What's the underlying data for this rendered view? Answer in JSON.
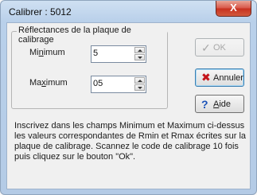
{
  "window": {
    "title": "Calibrer : 5012",
    "close_glyph": "X"
  },
  "group": {
    "legend": "Réflectances de la plaque de calibrage",
    "minimum": {
      "label_pre": "Mi",
      "label_acc": "n",
      "label_post": "imum",
      "value": "5"
    },
    "maximum": {
      "label_pre": "Ma",
      "label_acc": "x",
      "label_post": "imum",
      "value": "05"
    }
  },
  "buttons": {
    "ok": {
      "label": "OK",
      "icon": "check-icon",
      "enabled": false
    },
    "cancel": {
      "label": "Annuler",
      "icon": "x-icon"
    },
    "help": {
      "label_acc": "A",
      "label_post": "ide",
      "icon": "question-icon"
    }
  },
  "help_text": "Inscrivez dans les champs Minimum et Maximum ci-dessus les valeurs correspondantes de Rmin et Rmax écrites sur la plaque de calibrage. Scannez le code de calibrage 10 fois puis cliquez sur le bouton \"Ok\".",
  "colors": {
    "title_bar": "#b9d0ea",
    "close_button": "#c7301f",
    "cancel_icon": "#c4141a",
    "help_icon": "#1b53b8"
  }
}
